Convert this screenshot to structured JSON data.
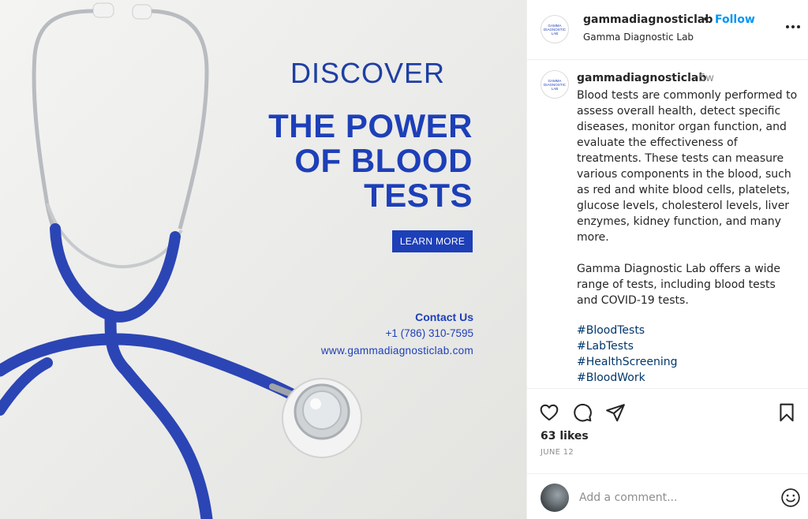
{
  "media": {
    "discover": "DISCOVER",
    "headline_lines": [
      "THE POWER",
      "OF BLOOD",
      "TESTS"
    ],
    "learn_more": "LEARN MORE",
    "contact_title": "Contact Us",
    "phone": "+1 (786) 310-7595",
    "website": "www.gammadiagnosticlab.com",
    "brand_color": "#1d3fb8",
    "tube_color": "#2b45b5"
  },
  "header": {
    "username": "gammadiagnosticlab",
    "separator": "•",
    "follow_label": "Follow",
    "subname": "Gamma Diagnostic Lab",
    "avatar_text": "GAMMA DIAGNOSTIC LAB",
    "more_icon": "more-horizontal-icon"
  },
  "caption": {
    "username": "gammadiagnosticlab",
    "time": "5w",
    "body": "Blood tests are commonly performed to assess overall health, detect specific diseases, monitor organ function, and evaluate the effectiveness of treatments. These tests can measure various components in the blood, such as red and white blood cells, platelets, glucose levels, cholesterol levels, liver enzymes, kidney function, and many more.\n\nGamma Diagnostic Lab offers a wide range of tests, including blood tests and COVID-19 tests.",
    "hashtags": [
      "#BloodTests",
      "#LabTests",
      "#HealthScreening",
      "#BloodWork"
    ]
  },
  "actions": {
    "icons": [
      "heart-icon",
      "comment-icon",
      "share-icon",
      "bookmark-icon"
    ]
  },
  "likes": "63 likes",
  "date": "JUNE 12",
  "comment": {
    "placeholder": "Add a comment...",
    "emoji_icon": "emoji-icon"
  }
}
